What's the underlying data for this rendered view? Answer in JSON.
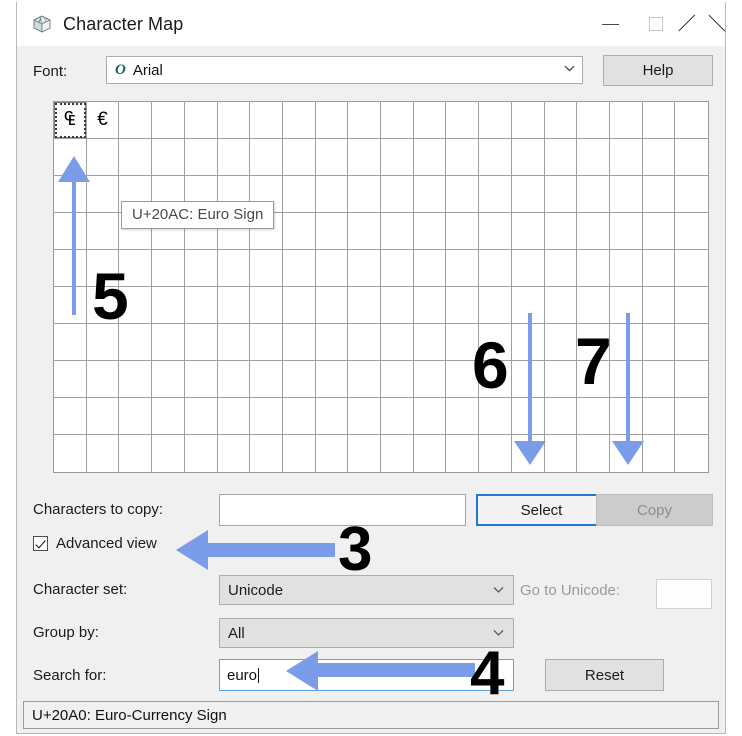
{
  "window": {
    "title": "Character Map",
    "icon": "character-map-icon",
    "controls": {
      "minimize": "minimize-icon",
      "maximize": "maximize-icon",
      "close": "close-icon"
    }
  },
  "font_row": {
    "label": "Font:",
    "font_icon": "O",
    "font_value": "Arial",
    "help_label": "Help"
  },
  "grid": {
    "columns": 20,
    "rows": 10,
    "cells": [
      "₠",
      "€"
    ],
    "selected_index": 0,
    "tooltip": "U+20AC: Euro Sign"
  },
  "characters_to_copy": {
    "label": "Characters to copy:",
    "value": "",
    "select_label": "Select",
    "copy_label": "Copy"
  },
  "advanced_view": {
    "label": "Advanced view",
    "checked": true
  },
  "character_set": {
    "label": "Character set:",
    "value": "Unicode",
    "goto_label": "Go to Unicode:",
    "goto_value": ""
  },
  "group_by": {
    "label": "Group by:",
    "value": "All"
  },
  "search": {
    "label": "Search for:",
    "value": "euro",
    "reset_label": "Reset"
  },
  "status_bar": {
    "text": "U+20A0: Euro-Currency Sign"
  },
  "annotations": {
    "arrow_color": "#7b9ce8",
    "items": [
      {
        "number": "3",
        "target": "advanced-view-checkbox",
        "direction": "left"
      },
      {
        "number": "4",
        "target": "search-input",
        "direction": "left"
      },
      {
        "number": "5",
        "target": "character-cell-selected",
        "direction": "up"
      },
      {
        "number": "6",
        "target": "select-button",
        "direction": "down"
      },
      {
        "number": "7",
        "target": "copy-button",
        "direction": "down"
      }
    ]
  }
}
